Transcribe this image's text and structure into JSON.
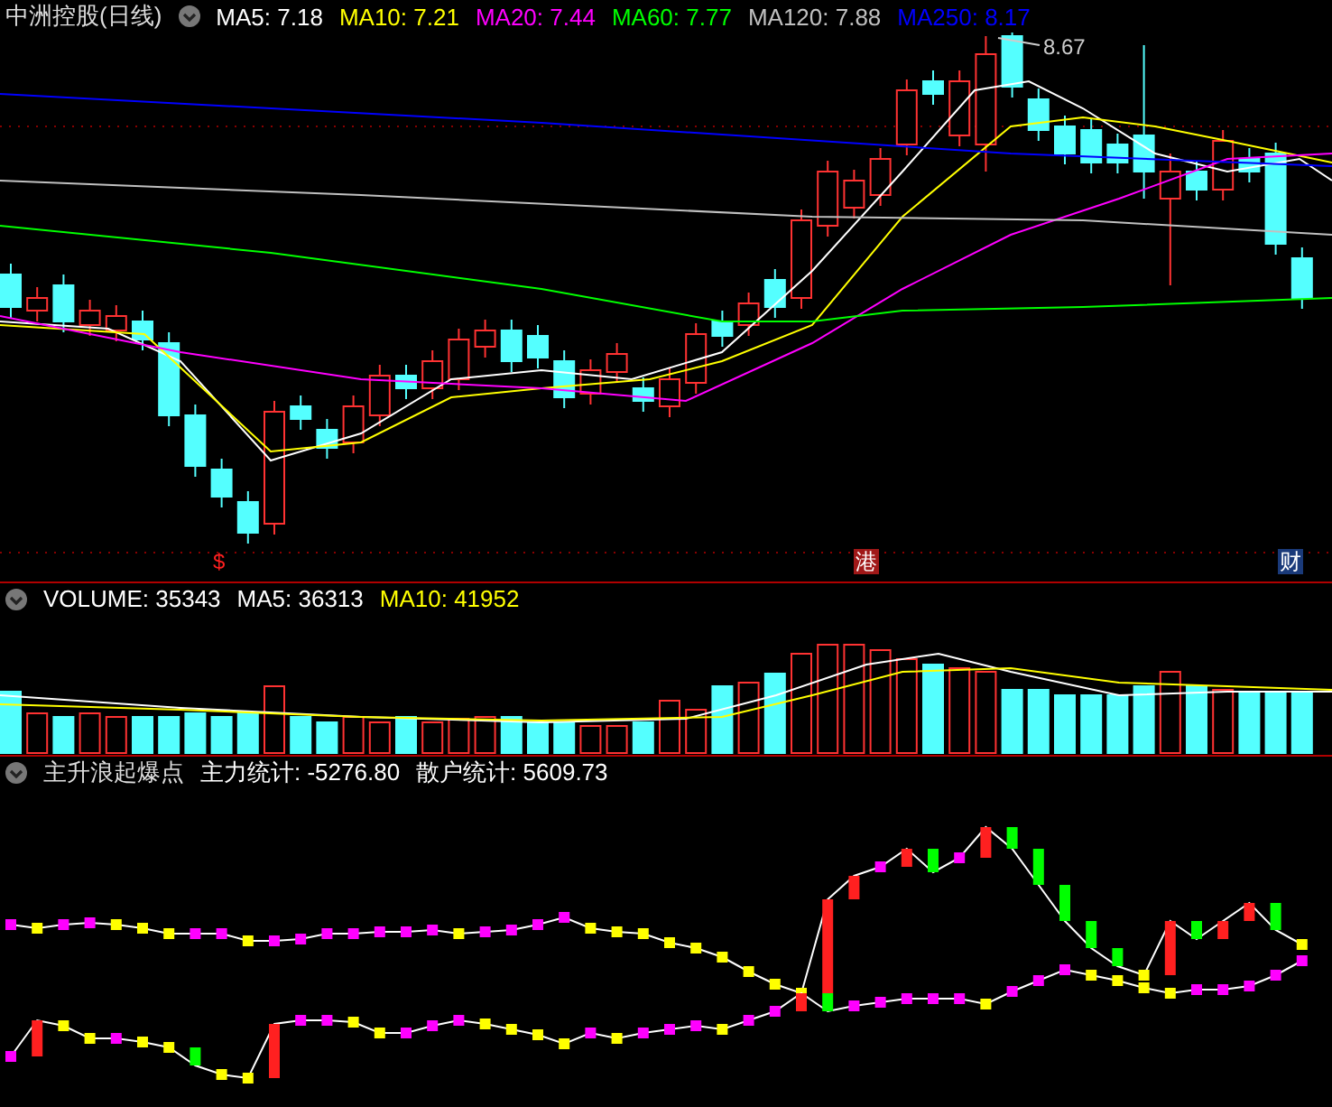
{
  "price_panel": {
    "title": "中洲控股(日线)",
    "legend": [
      {
        "label": "MA5: 7.18",
        "color": "#ffffff"
      },
      {
        "label": "MA10: 7.21",
        "color": "#ffff00"
      },
      {
        "label": "MA20: 7.44",
        "color": "#ff00ff"
      },
      {
        "label": "MA60: 7.77",
        "color": "#00ff00"
      },
      {
        "label": "MA120: 7.88",
        "color": "#c0c0c0"
      },
      {
        "label": "MA250: 8.17",
        "color": "#0000ff"
      }
    ],
    "high_label": "8.67",
    "markers": [
      {
        "kind": "dividend",
        "text": "$"
      },
      {
        "kind": "hk",
        "text": "港"
      },
      {
        "kind": "finance",
        "text": "财"
      }
    ]
  },
  "volume_panel": {
    "legend": [
      {
        "label": "VOLUME: 35343",
        "color": "#ffffff"
      },
      {
        "label": "MA5: 36313",
        "color": "#ffffff"
      },
      {
        "label": "MA10: 41952",
        "color": "#ffff00"
      }
    ]
  },
  "indicator_panel": {
    "title": "主升浪起爆点",
    "legend": [
      {
        "label": "主力统计: -5276.80",
        "color": "#ffffff"
      },
      {
        "label": "散户统计: 5609.73",
        "color": "#ffffff"
      }
    ]
  }
}
